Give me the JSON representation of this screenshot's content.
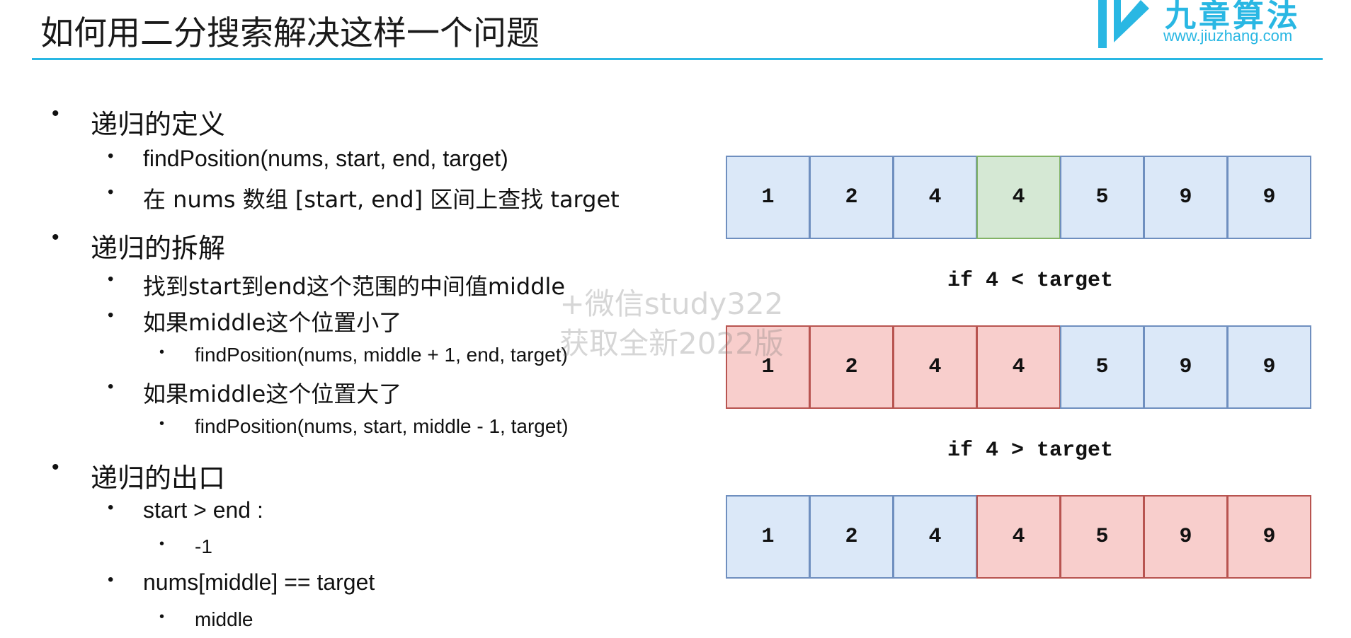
{
  "header": {
    "title": "如何用二分搜索解决这样一个问题",
    "logo": {
      "name": "九章算法",
      "url": "www.jiuzhang.com"
    },
    "accent_color": "#29b7e3"
  },
  "bullets": {
    "definition": {
      "label": "递归的定义",
      "items": [
        "findPosition(nums, start, end, target)",
        "在 nums 数组 [start, end] 区间上查找 target"
      ]
    },
    "decomposition": {
      "label": "递归的拆解",
      "item1": "找到start到end这个范围的中间值middle",
      "item2": "如果middle这个位置小了",
      "item2_sub": "findPosition(nums, middle + 1, end, target)",
      "item3": "如果middle这个位置大了",
      "item3_sub": "findPosition(nums, start, middle - 1, target)"
    },
    "exit": {
      "label": "递归的出口",
      "item1": "start > end :",
      "item1_sub": "-1",
      "item2": "nums[middle] == target",
      "item2_sub": "middle"
    }
  },
  "diagram": {
    "rows": [
      {
        "values": [
          "1",
          "2",
          "4",
          "4",
          "5",
          "9",
          "9"
        ],
        "states": [
          "blue",
          "blue",
          "blue",
          "green",
          "blue",
          "blue",
          "blue"
        ]
      },
      {
        "values": [
          "1",
          "2",
          "4",
          "4",
          "5",
          "9",
          "9"
        ],
        "states": [
          "red",
          "red",
          "red",
          "red",
          "blue",
          "blue",
          "blue"
        ]
      },
      {
        "values": [
          "1",
          "2",
          "4",
          "4",
          "5",
          "9",
          "9"
        ],
        "states": [
          "blue",
          "blue",
          "blue",
          "red",
          "red",
          "red",
          "red"
        ]
      }
    ],
    "conditions": [
      "if 4 < target",
      "if 4 > target"
    ],
    "colors": {
      "blue": "#dbe8f8",
      "green": "#d5e8d4",
      "red": "#f8cecc"
    }
  },
  "watermark": {
    "line1": "+微信study322",
    "line2": "获取全新2022版"
  }
}
